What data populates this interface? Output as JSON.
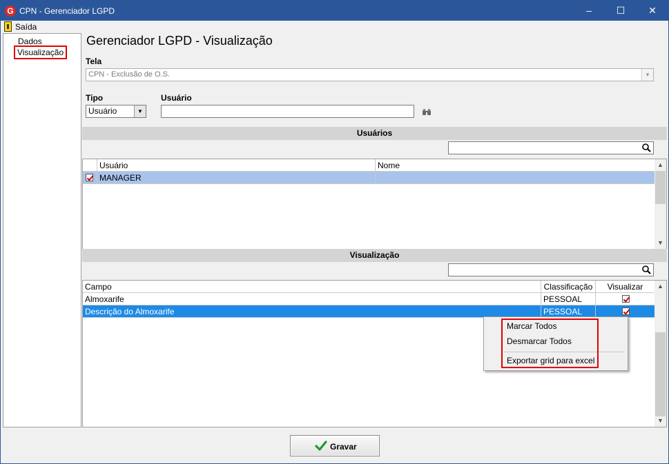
{
  "window": {
    "title": "CPN - Gerenciador LGPD",
    "minimize": "–",
    "maximize": "☐",
    "close": "✕"
  },
  "menu": {
    "exit_label": "Saída"
  },
  "nav": {
    "items": [
      {
        "label": "Dados"
      },
      {
        "label": "Visualização",
        "selected": true
      }
    ]
  },
  "page": {
    "title": "Gerenciador LGPD - Visualização"
  },
  "form": {
    "tela_label": "Tela",
    "tela_value": "CPN - Exclusão de O.S.",
    "tipo_label": "Tipo",
    "tipo_value": "Usuário",
    "usuario_label": "Usuário",
    "usuario_value": ""
  },
  "users_section": {
    "header": "Usuários",
    "search_value": "",
    "columns": [
      "Usuário",
      "Nome"
    ],
    "rows": [
      {
        "checked": true,
        "usuario": "MANAGER",
        "nome": ""
      }
    ]
  },
  "view_section": {
    "header": "Visualização",
    "search_value": "",
    "columns": [
      "Campo",
      "Classificação",
      "Visualizar"
    ],
    "rows": [
      {
        "campo": "Almoxarife",
        "classificacao": "PESSOAL",
        "visualizar": true,
        "selected": false
      },
      {
        "campo": "Descrição do Almoxarife",
        "classificacao": "PESSOAL",
        "visualizar": true,
        "selected": true
      }
    ]
  },
  "context_menu": {
    "items": [
      {
        "label": "Marcar Todos"
      },
      {
        "label": "Desmarcar Todos"
      },
      {
        "label": "Exportar grid para excel"
      }
    ]
  },
  "footer": {
    "save_label": "Gravar"
  },
  "colors": {
    "titlebar": "#2b579a",
    "selected_user_row": "#a9c4ec",
    "selected_view_row": "#1e8ae6",
    "highlight_outline": "#e00000"
  }
}
